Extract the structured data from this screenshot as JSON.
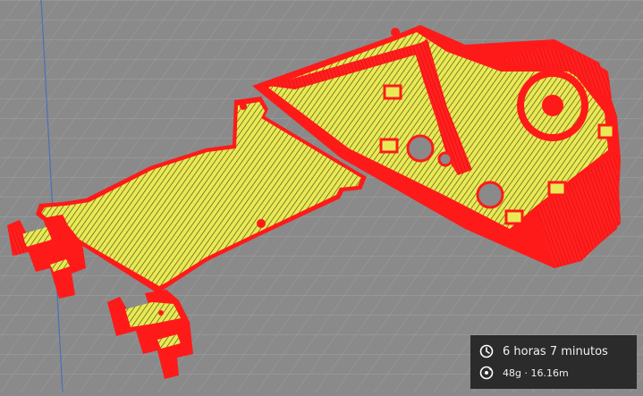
{
  "viewport": {
    "colors": {
      "background": "#8c8c8c",
      "grid": "#9b9b9b",
      "axis": "#4d6fb8",
      "wall": "#ff1a1a",
      "infill": "#e6e64d",
      "dark": "#3a3a10"
    }
  },
  "print_info": {
    "time": "6 horas 7 minutos",
    "time_icon": "clock-icon",
    "material": "48g · 16.16m",
    "material_icon": "spool-icon"
  }
}
